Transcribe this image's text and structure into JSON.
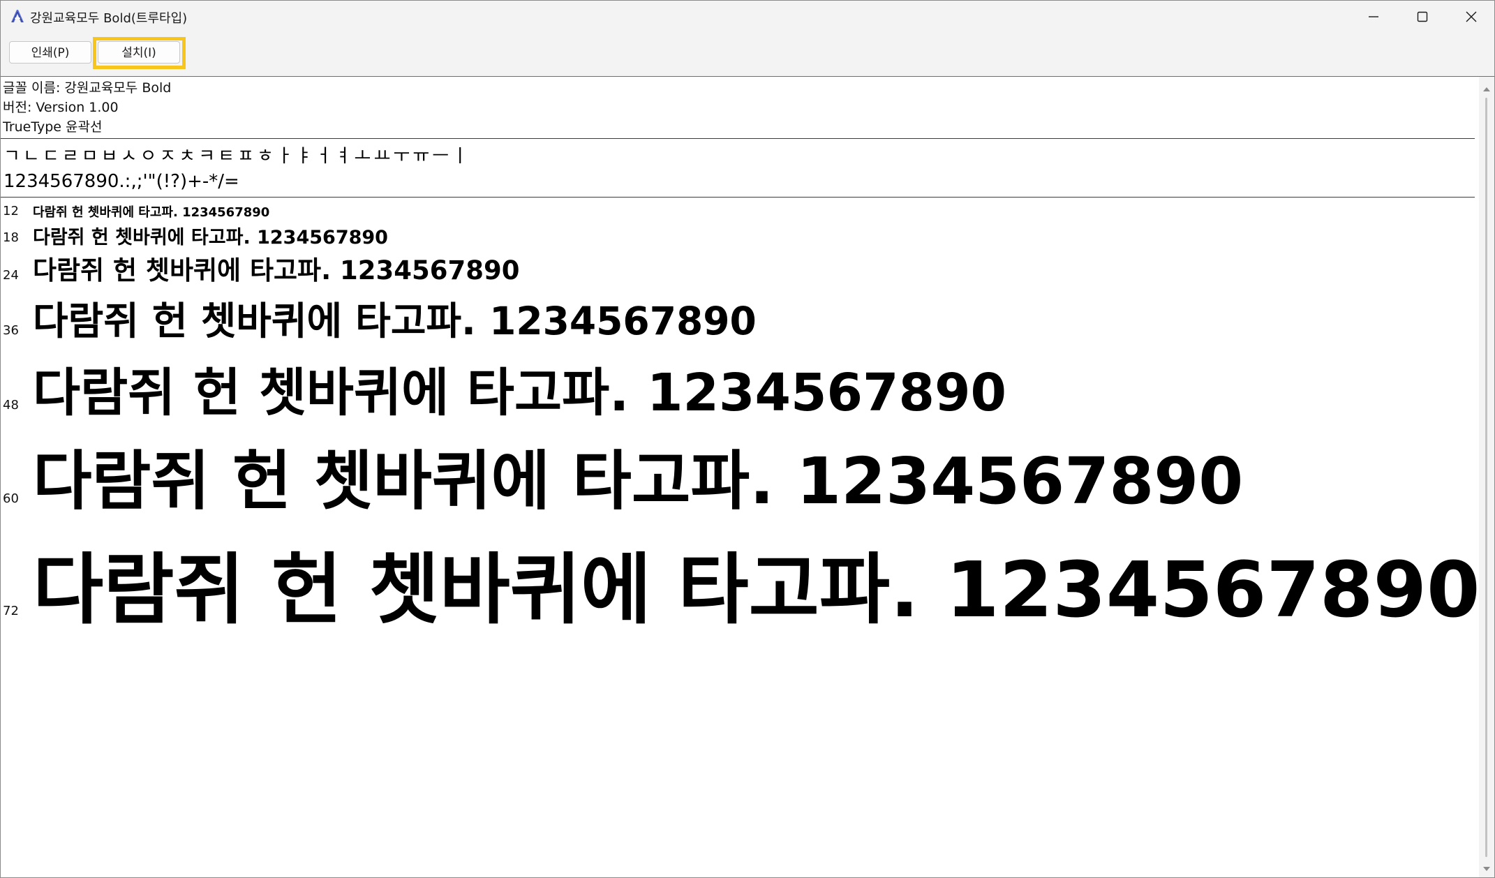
{
  "window": {
    "title": "강원교육모두 Bold(트루타입)",
    "icons": {
      "app": "font-viewer-icon",
      "minimize": "minimize-icon",
      "maximize": "maximize-icon",
      "close": "close-icon"
    }
  },
  "toolbar": {
    "print_label": "인쇄(P)",
    "install_label": "설치(I)",
    "highlight_color": "#f7c51b"
  },
  "info": {
    "font_name": "글꼴 이름: 강원교육모두 Bold",
    "version": "버전: Version 1.00",
    "type": "TrueType 윤곽선"
  },
  "charset": {
    "jamo": "ㄱㄴㄷㄹㅁㅂㅅㅇㅈㅊㅋㅌㅍㅎㅏㅑㅓㅕㅗㅛㅜㅠㅡㅣ",
    "symbols": "1234567890.:,;'\"(!?)+-*/="
  },
  "samples": [
    {
      "size": "12",
      "text": "다람쥐 헌 쳇바퀴에 타고파. 1234567890"
    },
    {
      "size": "18",
      "text": "다람쥐 헌 쳇바퀴에 타고파. 1234567890"
    },
    {
      "size": "24",
      "text": "다람쥐 헌 쳇바퀴에 타고파. 1234567890"
    },
    {
      "size": "36",
      "text": "다람쥐 헌 쳇바퀴에 타고파. 1234567890"
    },
    {
      "size": "48",
      "text": "다람쥐 헌 쳇바퀴에 타고파. 1234567890"
    },
    {
      "size": "60",
      "text": "다람쥐 헌 쳇바퀴에 타고파. 1234567890"
    },
    {
      "size": "72",
      "text": "다람쥐 헌 쳇바퀴에 타고파. 1234567890"
    }
  ]
}
